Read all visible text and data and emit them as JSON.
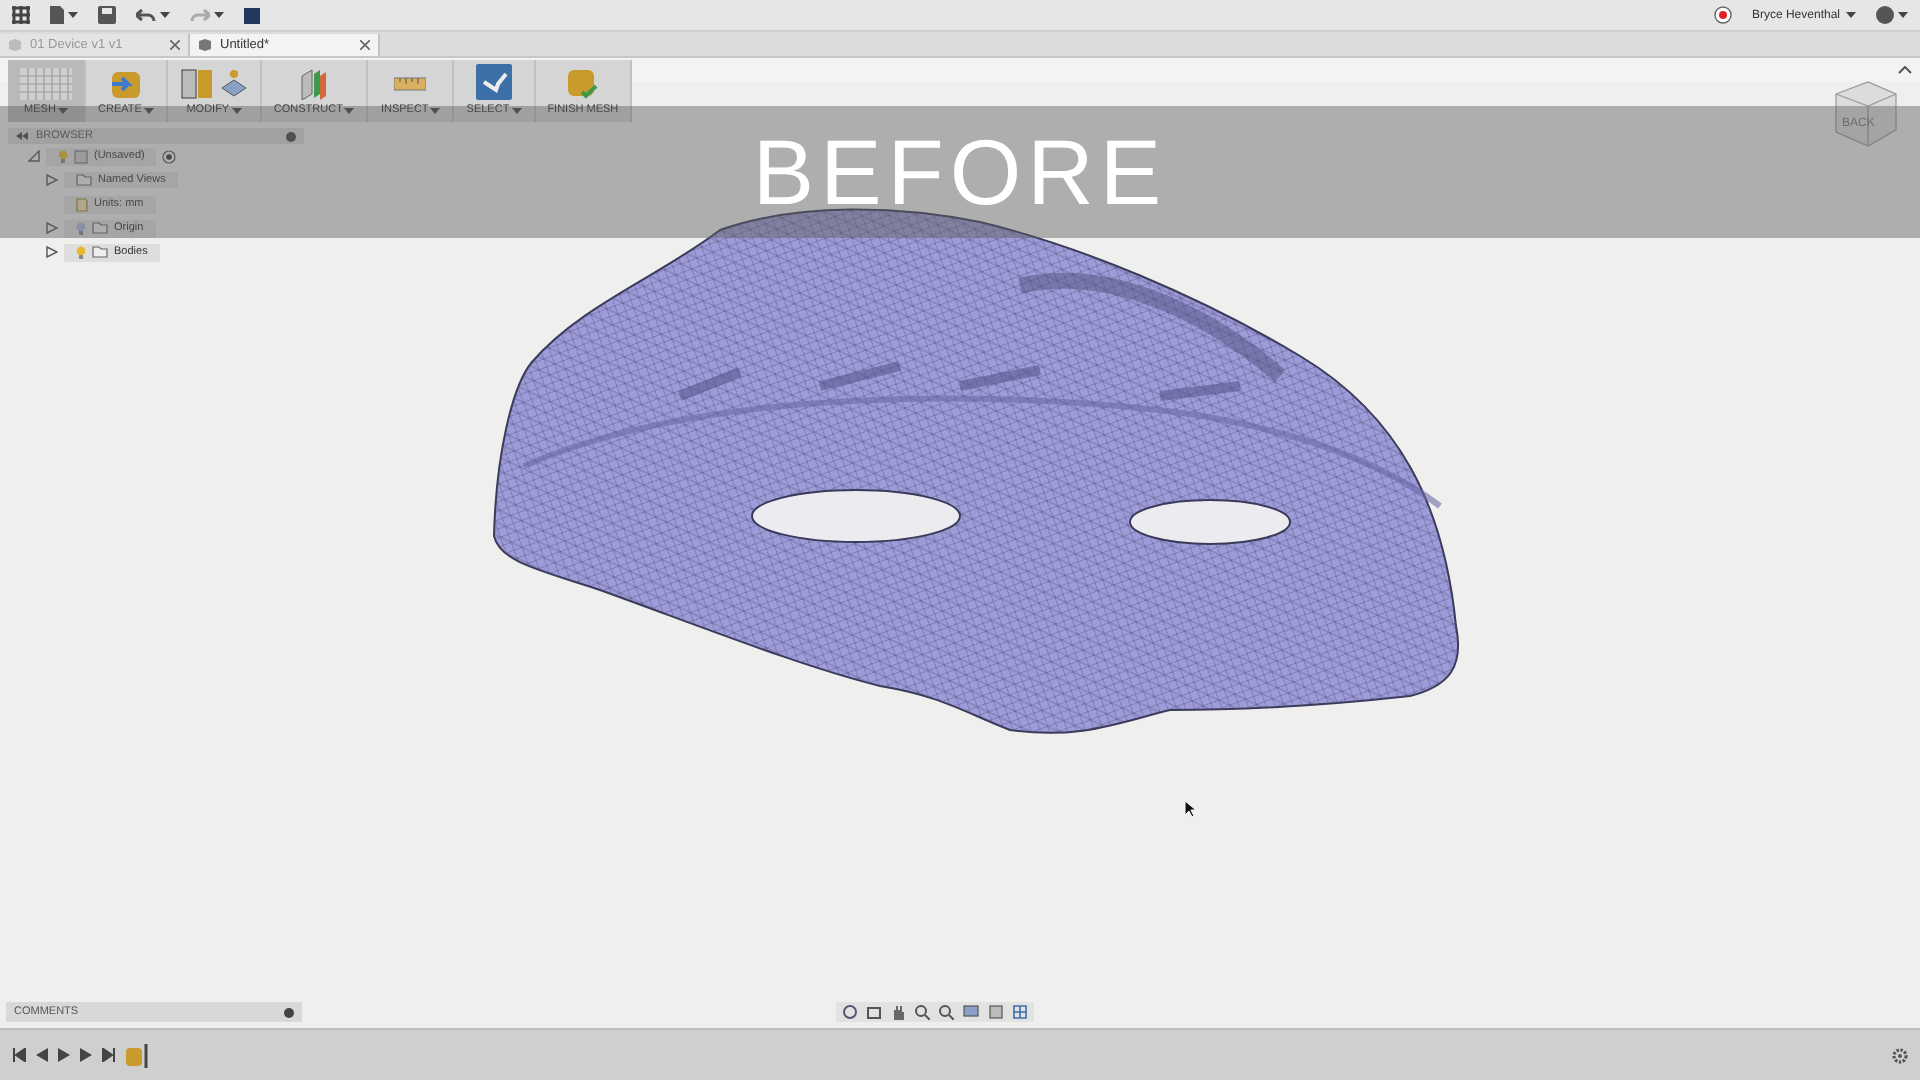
{
  "app_bar": {
    "user_name": "Bryce Heventhal"
  },
  "tabs": [
    {
      "label": "01 Device v1 v1",
      "selected": false
    },
    {
      "label": "Untitled*",
      "selected": true
    }
  ],
  "toolbar": [
    {
      "kind": "mesh",
      "label": "MESH",
      "dropdown": true,
      "selected": true
    },
    {
      "kind": "create",
      "label": "CREATE",
      "dropdown": true,
      "selected": false
    },
    {
      "kind": "modify",
      "label": "MODIFY",
      "dropdown": true,
      "selected": false
    },
    {
      "kind": "construct",
      "label": "CONSTRUCT",
      "dropdown": true,
      "selected": false
    },
    {
      "kind": "inspect",
      "label": "INSPECT",
      "dropdown": true,
      "selected": false
    },
    {
      "kind": "select",
      "label": "SELECT",
      "dropdown": true,
      "selected": false
    },
    {
      "kind": "finish",
      "label": "FINISH MESH",
      "dropdown": false,
      "selected": false
    }
  ],
  "browser": {
    "title": "BROWSER",
    "tree": [
      {
        "kind": "component",
        "label": "(Unsaved)",
        "expanded": true,
        "visible": true,
        "active": true,
        "children": [
          {
            "kind": "folder",
            "label": "Named Views",
            "expanded": false
          },
          {
            "kind": "units",
            "label": "Units: mm"
          },
          {
            "kind": "folder",
            "label": "Origin",
            "expanded": false,
            "visible": false
          },
          {
            "kind": "folder",
            "label": "Bodies",
            "expanded": false,
            "visible": true
          }
        ]
      }
    ]
  },
  "overlay_caption": "BEFORE",
  "view_cube": {
    "face": "BACK"
  },
  "comments": {
    "title": "COMMENTS"
  }
}
